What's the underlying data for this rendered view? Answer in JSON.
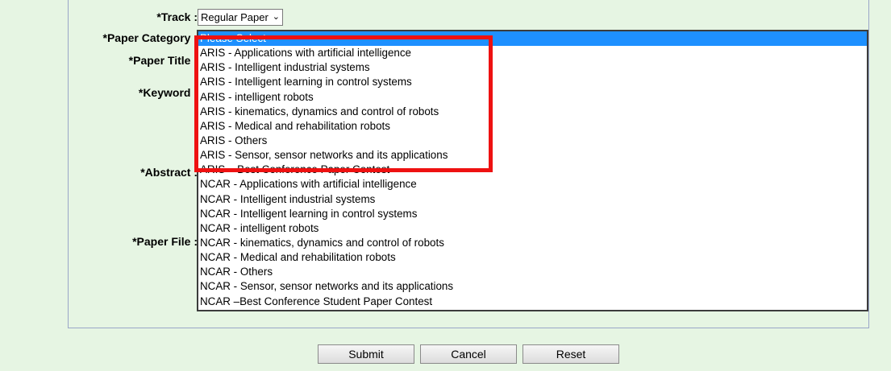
{
  "form": {
    "labels": {
      "track": "*Track :",
      "paper_category": "*Paper Category :",
      "paper_title": "*Paper Title :",
      "keyword": "*Keyword :",
      "abstract": "*Abstract :",
      "paper_file": "*Paper File :"
    },
    "track": {
      "selected": "Regular Paper"
    },
    "paper_category": {
      "selected_index": 0,
      "options": [
        "Please Select",
        "ARIS - Applications with artificial intelligence",
        "ARIS - Intelligent industrial systems",
        "ARIS - Intelligent learning in control systems",
        "ARIS - intelligent robots",
        "ARIS - kinematics, dynamics and control of robots",
        "ARIS - Medical and rehabilitation robots",
        "ARIS - Others",
        "ARIS - Sensor, sensor networks and its applications",
        "ARIS – Best Conference Paper Contest",
        "NCAR - Applications with artificial intelligence",
        "NCAR - Intelligent industrial systems",
        "NCAR - Intelligent learning in control systems",
        "NCAR - intelligent robots",
        "NCAR - kinematics, dynamics and control of robots",
        "NCAR - Medical and rehabilitation robots",
        "NCAR - Others",
        "NCAR - Sensor, sensor networks and its applications",
        "NCAR –Best Conference Student Paper Contest"
      ]
    }
  },
  "buttons": {
    "submit": "Submit",
    "cancel": "Cancel",
    "reset": "Reset"
  },
  "colors": {
    "background": "#e6f5e3",
    "selection": "#1e90ff",
    "highlight": "#ee1111"
  }
}
